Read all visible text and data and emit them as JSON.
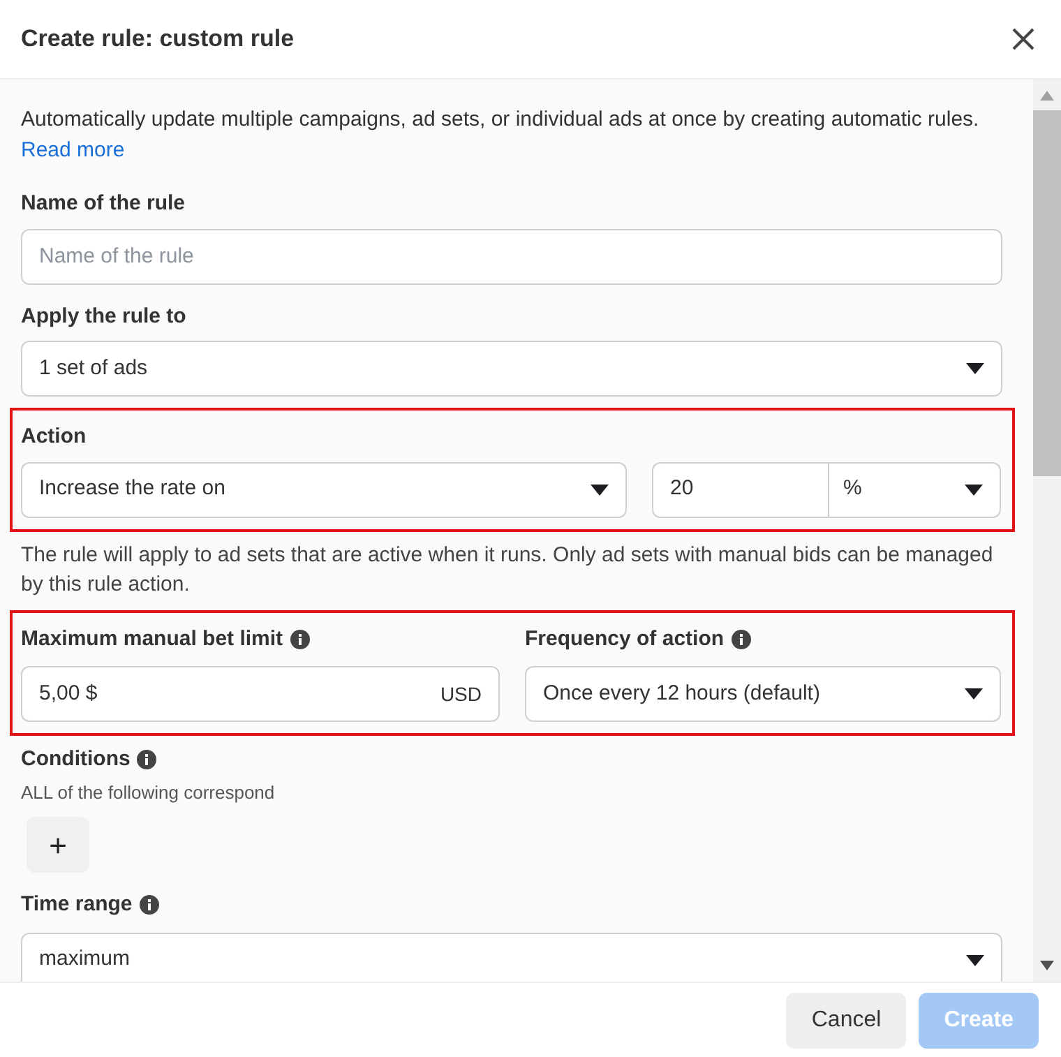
{
  "dialog": {
    "title": "Create rule: custom rule"
  },
  "intro": {
    "text": "Automatically update multiple campaigns, ad sets, or individual ads at once by creating automatic rules.",
    "link": "Read more"
  },
  "name_field": {
    "label": "Name of the rule",
    "placeholder": "Name of the rule"
  },
  "apply_to": {
    "label": "Apply the rule to",
    "value": "1 set of ads"
  },
  "action": {
    "highlighted": true,
    "label": "Action",
    "value": "Increase the rate on",
    "amount": "20",
    "unit": "%"
  },
  "action_note": "The rule will apply to ad sets that are active when it runs. Only ad sets with manual bids can be managed by this rule action.",
  "limits": {
    "highlighted": true,
    "bid_limit": {
      "label": "Maximum manual bet limit",
      "value": "5,00 $",
      "currency": "USD"
    },
    "frequency": {
      "label": "Frequency of action",
      "value": "Once every 12 hours (default)"
    }
  },
  "conditions": {
    "label": "Conditions",
    "sublabel": "ALL of the following correspond",
    "add_button": "+"
  },
  "time_range": {
    "label": "Time range",
    "value": "maximum"
  },
  "footer": {
    "buttons": [
      {
        "label": "Cancel",
        "kind": "secondary",
        "disabled": false
      },
      {
        "label": "Create",
        "kind": "primary",
        "disabled": true
      }
    ]
  }
}
